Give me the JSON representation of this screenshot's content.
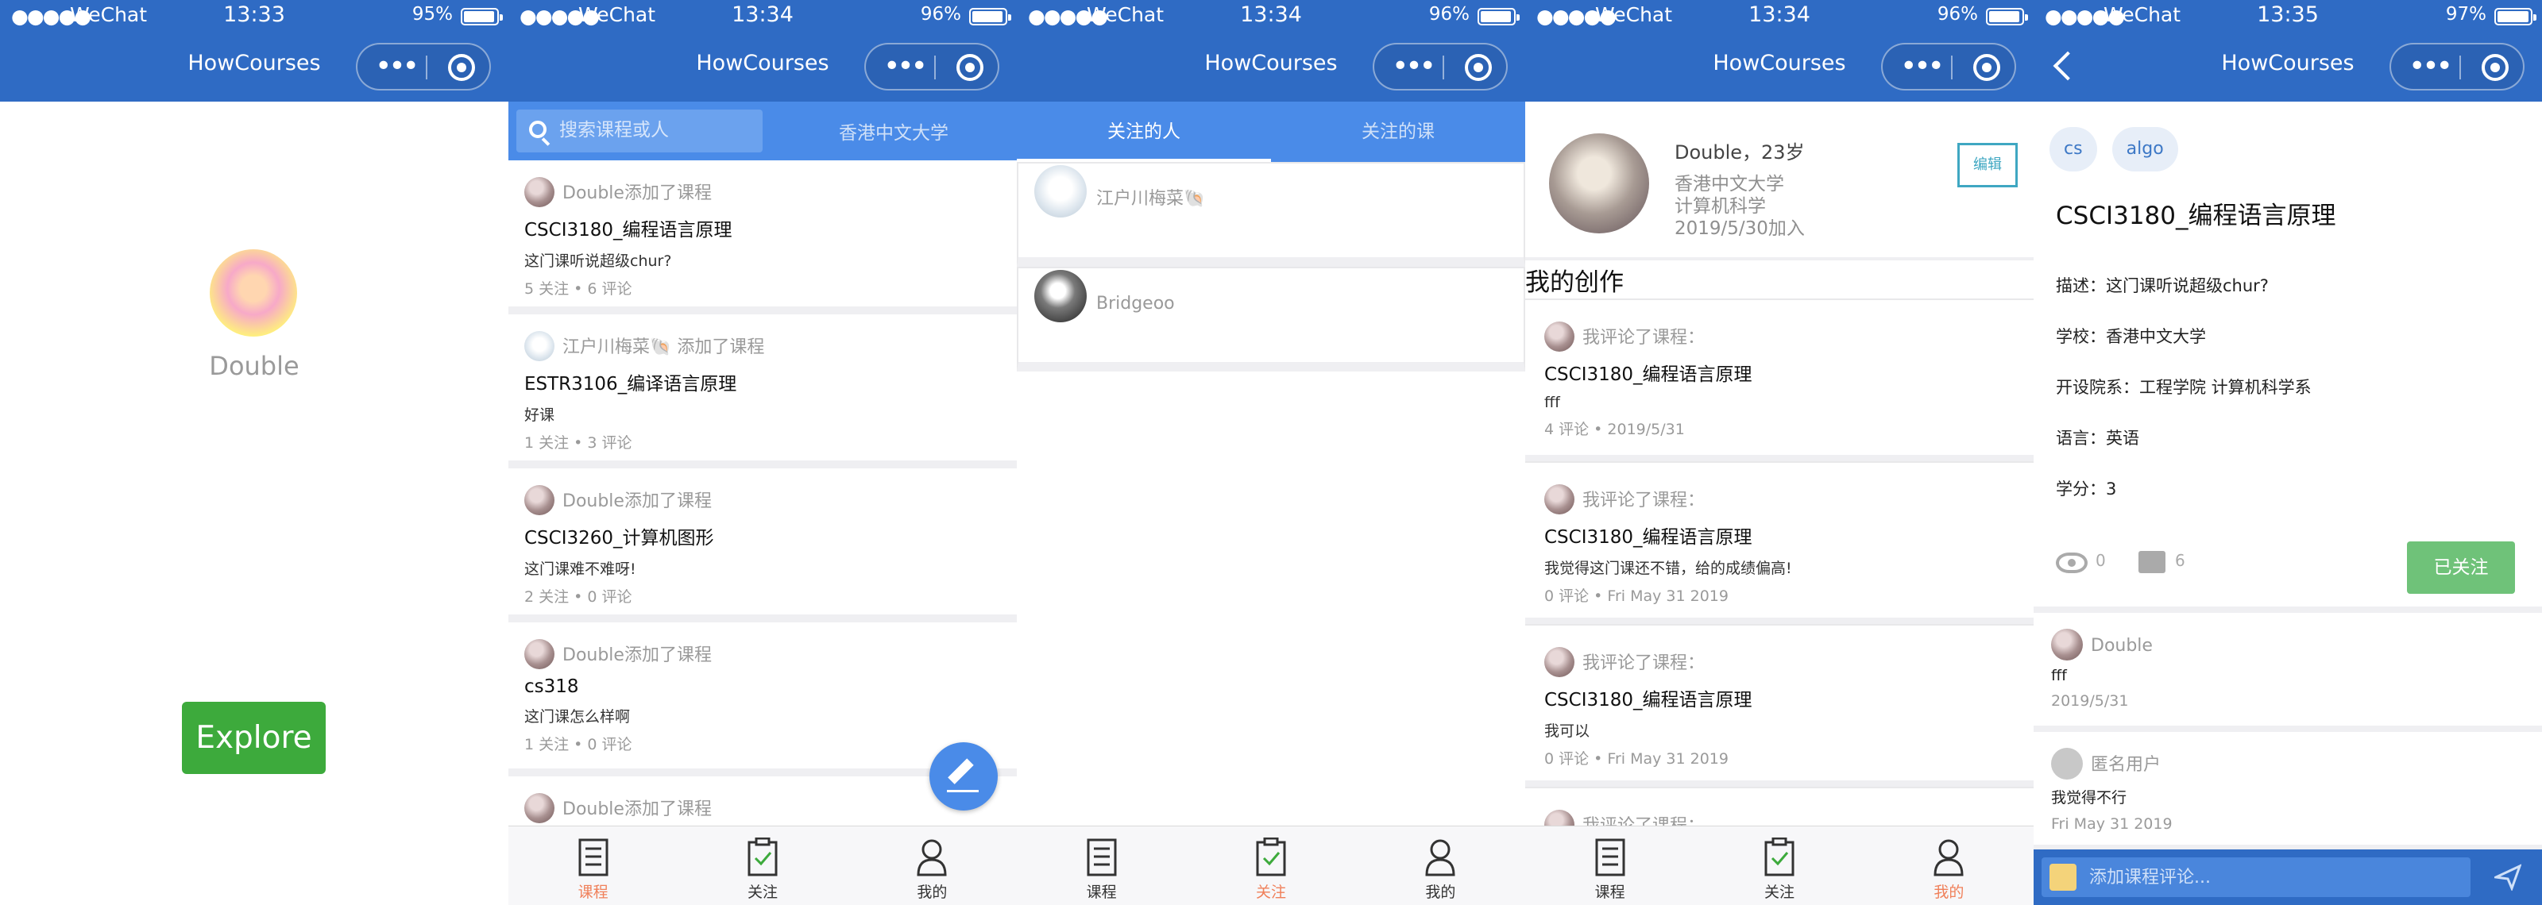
{
  "status_bars": [
    {
      "carrier": "WeChat",
      "time": "13:33",
      "battery": "95%",
      "battery_level": 0.95
    },
    {
      "carrier": "WeChat",
      "time": "13:34",
      "battery": "96%",
      "battery_level": 0.96
    },
    {
      "carrier": "WeChat",
      "time": "13:34",
      "battery": "96%",
      "battery_level": 0.96
    },
    {
      "carrier": "WeChat",
      "time": "13:34",
      "battery": "96%",
      "battery_level": 0.96
    },
    {
      "carrier": "WeChat",
      "time": "13:35",
      "battery": "97%",
      "battery_level": 0.97
    }
  ],
  "nav_title": "HowCourses",
  "colors": {
    "navbar": "#2f6bc4",
    "accent_blue": "#4a8be8",
    "explore_green": "#3daa3c",
    "active_tab": "#f0805a",
    "followed_green": "#6fc279"
  },
  "screen1": {
    "user_name": "Double",
    "explore_label": "Explore"
  },
  "screen2": {
    "search_placeholder": "搜索课程或人",
    "school_filter": "香港中文大学",
    "feed": [
      {
        "user": "Double",
        "action": "添加了课程",
        "course": "CSCI3180_编程语言原理",
        "desc": "这门课听说超级chur?",
        "meta": "5 关注 • 6 评论"
      },
      {
        "user": "江户川梅菜🐚",
        "action": "添加了课程",
        "course": "ESTR3106_编译语言原理",
        "desc": "好课",
        "meta": "1 关注 • 3 评论"
      },
      {
        "user": "Double",
        "action": "添加了课程",
        "course": "CSCI3260_计算机图形",
        "desc": "这门课难不难呀!",
        "meta": "2 关注 • 0 评论"
      },
      {
        "user": "Double",
        "action": "添加了课程",
        "course": "cs318",
        "desc": "这门课怎么样啊",
        "meta": "1 关注 • 0 评论"
      },
      {
        "user": "Double",
        "action": "添加了课程",
        "course": "",
        "desc": "",
        "meta": ""
      }
    ],
    "fab_icon": "edit-pencil-icon"
  },
  "tabbar": {
    "courses": "课程",
    "following": "关注",
    "mine": "我的"
  },
  "screen3": {
    "tabs": [
      "关注的人",
      "关注的课"
    ],
    "people": [
      "江户川梅菜🐚",
      "Bridgeoo"
    ]
  },
  "screen4": {
    "name_age": "Double，23岁",
    "school": "香港中文大学",
    "major": "计算机科学",
    "joined": "2019/5/30加入",
    "edit_label": "编辑",
    "section_title": "我的创作",
    "creations": [
      {
        "head": "我评论了课程：",
        "course": "CSCI3180_编程语言原理",
        "text": "fff",
        "meta": "4 评论 • 2019/5/31"
      },
      {
        "head": "我评论了课程：",
        "course": "CSCI3180_编程语言原理",
        "text": "我觉得这门课还不错，给的成绩偏高!",
        "meta": "0 评论 • Fri May 31 2019"
      },
      {
        "head": "我评论了课程：",
        "course": "CSCI3180_编程语言原理",
        "text": "我可以",
        "meta": "0 评论 • Fri May 31 2019"
      },
      {
        "head": "我评论了课程：",
        "course": "",
        "text": "",
        "meta": ""
      }
    ]
  },
  "screen5": {
    "tags": [
      "cs",
      "algo"
    ],
    "course_title": "CSCI3180_编程语言原理",
    "details": [
      "描述：这门课听说超级chur?",
      "学校：香港中文大学",
      "开设院系：工程学院 计算机科学系",
      "语言：英语",
      "学分：3"
    ],
    "views": "0",
    "comments_count": "6",
    "followed_label": "已关注",
    "comments": [
      {
        "user": "Double",
        "text": "fff",
        "time": "2019/5/31"
      },
      {
        "user": "匿名用户",
        "text": "我觉得不行",
        "time": "Fri May 31 2019"
      }
    ],
    "comment_placeholder": "添加课程评论..."
  }
}
